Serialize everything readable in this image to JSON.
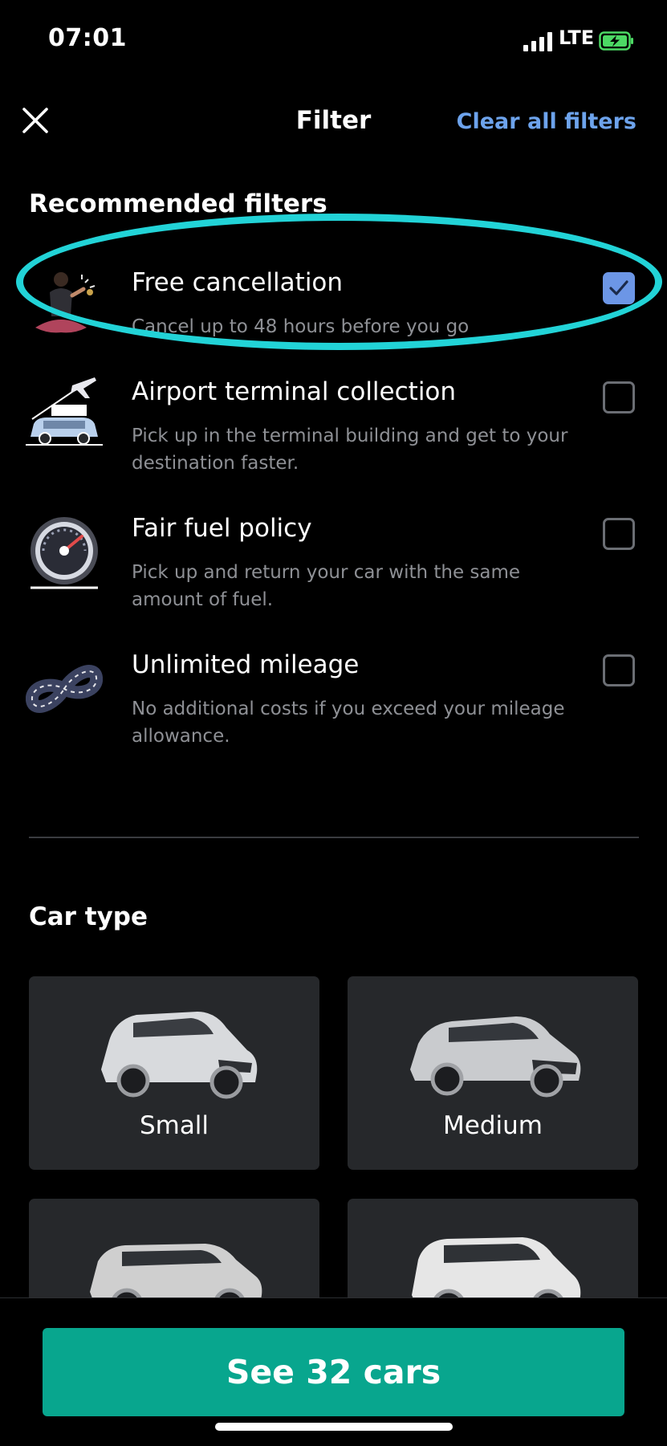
{
  "status_bar": {
    "time": "07:01",
    "network": "LTE",
    "battery_color": "#4cd964"
  },
  "header": {
    "title": "Filter",
    "clear_label": "Clear all filters"
  },
  "recommended": {
    "title": "Recommended filters",
    "items": [
      {
        "title": "Free cancellation",
        "description": "Cancel up to 48 hours before you go",
        "checked": true,
        "icon": "person-meditating-icon"
      },
      {
        "title": "Airport terminal collection",
        "description": "Pick up in the terminal building and get to your destination faster.",
        "checked": false,
        "icon": "airport-car-icon"
      },
      {
        "title": "Fair fuel policy",
        "description": "Pick up and return your car with the same amount of fuel.",
        "checked": false,
        "icon": "fuel-gauge-icon"
      },
      {
        "title": "Unlimited mileage",
        "description": "No additional costs if you exceed your mileage allowance.",
        "checked": false,
        "icon": "infinity-road-icon"
      }
    ]
  },
  "car_type": {
    "title": "Car type",
    "tiles": [
      {
        "label": "Small"
      },
      {
        "label": "Medium"
      },
      {
        "label": ""
      },
      {
        "label": ""
      }
    ]
  },
  "footer": {
    "button_label": "See 32 cars"
  },
  "colors": {
    "accent_link": "#6da3ec",
    "checkbox_checked": "#6c96e6",
    "primary_button": "#08a68e",
    "highlight_ring": "#22d3d7"
  }
}
